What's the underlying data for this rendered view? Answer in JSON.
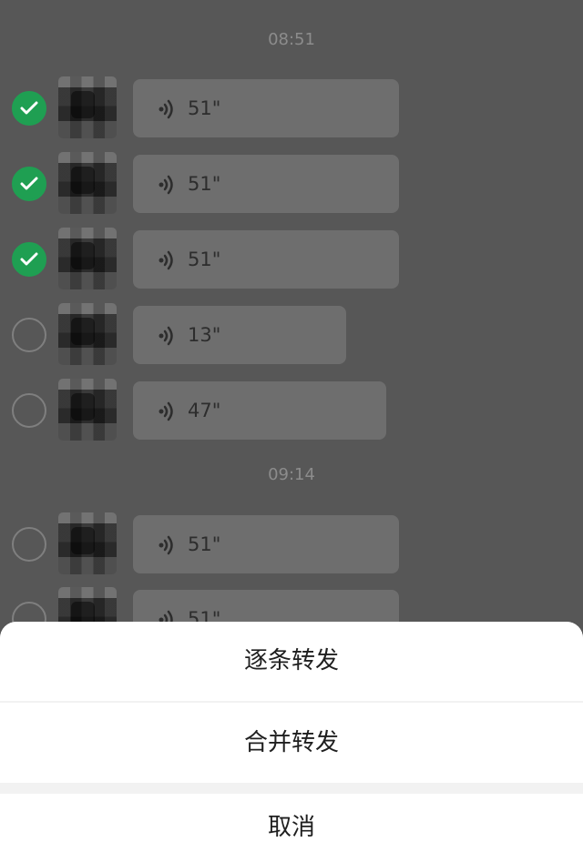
{
  "timestamps": [
    "08:51",
    "09:14"
  ],
  "messages": [
    {
      "duration": "51\"",
      "selected": true
    },
    {
      "duration": "51\"",
      "selected": true
    },
    {
      "duration": "51\"",
      "selected": true
    },
    {
      "duration": "13\"",
      "selected": false
    },
    {
      "duration": "47\"",
      "selected": false
    },
    {
      "duration": "51\"",
      "selected": false
    },
    {
      "duration": "51\"",
      "selected": false
    }
  ],
  "action_sheet": {
    "forward_one_by_one": "逐条转发",
    "merge_forward": "合并转发",
    "cancel": "取消"
  },
  "colors": {
    "checked": "#1f9f52",
    "overlay_bg": "#575757",
    "sheet_bg": "#ffffff"
  },
  "icons": [
    "check-icon",
    "voice-icon",
    "avatar"
  ]
}
